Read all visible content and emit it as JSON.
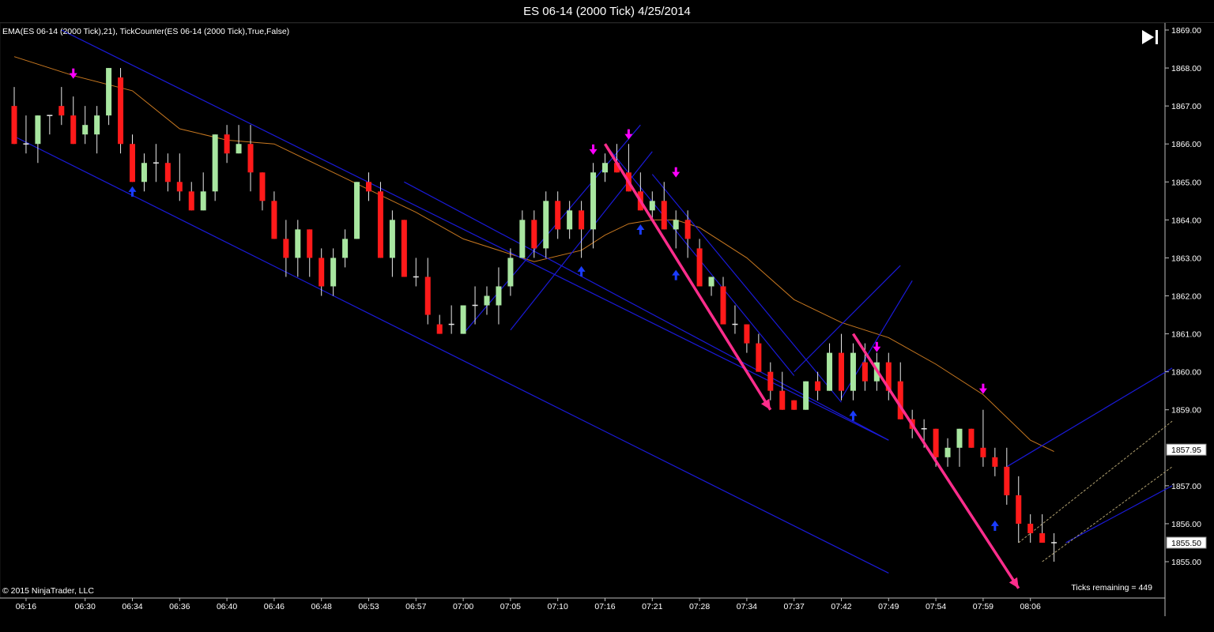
{
  "window": {
    "title": "ES 06-14 (2000 Tick)  4/25/2014"
  },
  "indicator_label": "EMA(ES 06-14 (2000 Tick),21), TickCounter(ES 06-14 (2000 Tick),True,False)",
  "copyright": "© 2015 NinjaTrader, LLC",
  "ticks_remaining": "Ticks remaining = 449",
  "icons": {
    "scroll_end": "skip-to-end-icon"
  },
  "colors": {
    "background": "#000000",
    "up_candle": "#a8e6a0",
    "down_candle": "#ff1a1a",
    "ema": "#c87820",
    "channel": "#1a1ad8",
    "trend_arrow": "#ff2d8c",
    "sell_arrow": "#ff00ff",
    "buy_arrow": "#1a3cff",
    "fib_line": "#b0a070"
  },
  "chart_data": {
    "type": "candlestick",
    "title": "ES 06-14 (2000 Tick)  4/25/2014",
    "ylim": [
      1854.3,
      1869.1
    ],
    "y_ticks": [
      "1869.00",
      "1868.00",
      "1867.00",
      "1866.00",
      "1865.00",
      "1864.00",
      "1863.00",
      "1862.00",
      "1861.00",
      "1860.00",
      "1859.00",
      "1857.00",
      "1856.00",
      "1855.00"
    ],
    "price_markers": [
      {
        "label": "1857.95",
        "value": 1857.95
      },
      {
        "label": "1855.50",
        "value": 1855.5
      }
    ],
    "x_tick_labels": [
      {
        "label": "06:16",
        "i": 1
      },
      {
        "label": "06:30",
        "i": 6
      },
      {
        "label": "06:34",
        "i": 10
      },
      {
        "label": "06:36",
        "i": 14
      },
      {
        "label": "06:40",
        "i": 18
      },
      {
        "label": "06:46",
        "i": 22
      },
      {
        "label": "06:48",
        "i": 26
      },
      {
        "label": "06:53",
        "i": 30
      },
      {
        "label": "06:57",
        "i": 34
      },
      {
        "label": "07:00",
        "i": 38
      },
      {
        "label": "07:05",
        "i": 42
      },
      {
        "label": "07:10",
        "i": 46
      },
      {
        "label": "07:16",
        "i": 50
      },
      {
        "label": "07:21",
        "i": 54
      },
      {
        "label": "07:28",
        "i": 58
      },
      {
        "label": "07:34",
        "i": 62
      },
      {
        "label": "07:37",
        "i": 66
      },
      {
        "label": "07:42",
        "i": 70
      },
      {
        "label": "07:49",
        "i": 74
      },
      {
        "label": "07:54",
        "i": 78
      },
      {
        "label": "07:59",
        "i": 82
      },
      {
        "label": "08:06",
        "i": 86
      }
    ],
    "candles": [
      {
        "o": 1867.0,
        "h": 1867.5,
        "l": 1866.0,
        "c": 1866.0
      },
      {
        "o": 1866.0,
        "h": 1866.75,
        "l": 1865.75,
        "c": 1866.0
      },
      {
        "o": 1866.0,
        "h": 1866.75,
        "l": 1865.5,
        "c": 1866.75
      },
      {
        "o": 1866.75,
        "h": 1866.75,
        "l": 1866.25,
        "c": 1866.75
      },
      {
        "o": 1867.0,
        "h": 1867.5,
        "l": 1866.5,
        "c": 1866.75
      },
      {
        "o": 1866.75,
        "h": 1867.25,
        "l": 1866.0,
        "c": 1866.0
      },
      {
        "o": 1866.25,
        "h": 1867.0,
        "l": 1866.0,
        "c": 1866.5
      },
      {
        "o": 1866.25,
        "h": 1867.0,
        "l": 1865.75,
        "c": 1866.75
      },
      {
        "o": 1866.75,
        "h": 1868.0,
        "l": 1866.5,
        "c": 1868.0
      },
      {
        "o": 1867.75,
        "h": 1868.0,
        "l": 1865.75,
        "c": 1866.0
      },
      {
        "o": 1866.0,
        "h": 1866.25,
        "l": 1865.0,
        "c": 1865.0
      },
      {
        "o": 1865.0,
        "h": 1865.75,
        "l": 1864.75,
        "c": 1865.5
      },
      {
        "o": 1865.5,
        "h": 1866.0,
        "l": 1865.0,
        "c": 1865.5
      },
      {
        "o": 1865.5,
        "h": 1865.75,
        "l": 1864.75,
        "c": 1865.0
      },
      {
        "o": 1865.0,
        "h": 1865.75,
        "l": 1864.5,
        "c": 1864.75
      },
      {
        "o": 1864.75,
        "h": 1865.0,
        "l": 1864.25,
        "c": 1864.25
      },
      {
        "o": 1864.25,
        "h": 1865.25,
        "l": 1864.25,
        "c": 1864.75
      },
      {
        "o": 1864.75,
        "h": 1866.25,
        "l": 1864.5,
        "c": 1866.25
      },
      {
        "o": 1866.25,
        "h": 1866.5,
        "l": 1865.5,
        "c": 1865.75
      },
      {
        "o": 1865.75,
        "h": 1866.5,
        "l": 1865.75,
        "c": 1866.0
      },
      {
        "o": 1866.0,
        "h": 1866.5,
        "l": 1864.75,
        "c": 1865.25
      },
      {
        "o": 1865.25,
        "h": 1865.25,
        "l": 1864.25,
        "c": 1864.5
      },
      {
        "o": 1864.5,
        "h": 1864.75,
        "l": 1863.5,
        "c": 1863.5
      },
      {
        "o": 1863.5,
        "h": 1864.0,
        "l": 1862.5,
        "c": 1863.0
      },
      {
        "o": 1863.0,
        "h": 1864.0,
        "l": 1862.5,
        "c": 1863.75
      },
      {
        "o": 1863.75,
        "h": 1863.75,
        "l": 1862.5,
        "c": 1863.0
      },
      {
        "o": 1863.0,
        "h": 1863.25,
        "l": 1862.0,
        "c": 1862.25
      },
      {
        "o": 1862.25,
        "h": 1863.25,
        "l": 1862.0,
        "c": 1863.0
      },
      {
        "o": 1863.0,
        "h": 1863.75,
        "l": 1862.75,
        "c": 1863.5
      },
      {
        "o": 1863.5,
        "h": 1865.0,
        "l": 1863.5,
        "c": 1865.0
      },
      {
        "o": 1865.0,
        "h": 1865.25,
        "l": 1864.5,
        "c": 1864.75
      },
      {
        "o": 1864.75,
        "h": 1865.0,
        "l": 1863.0,
        "c": 1863.0
      },
      {
        "o": 1863.0,
        "h": 1864.25,
        "l": 1862.5,
        "c": 1864.0
      },
      {
        "o": 1864.0,
        "h": 1864.0,
        "l": 1862.5,
        "c": 1862.5
      },
      {
        "o": 1862.5,
        "h": 1863.0,
        "l": 1862.25,
        "c": 1862.5
      },
      {
        "o": 1862.5,
        "h": 1863.0,
        "l": 1861.25,
        "c": 1861.5
      },
      {
        "o": 1861.25,
        "h": 1861.5,
        "l": 1861.0,
        "c": 1861.0
      },
      {
        "o": 1861.25,
        "h": 1861.75,
        "l": 1861.0,
        "c": 1861.25
      },
      {
        "o": 1861.0,
        "h": 1861.75,
        "l": 1861.0,
        "c": 1861.75
      },
      {
        "o": 1861.75,
        "h": 1862.25,
        "l": 1861.25,
        "c": 1861.75
      },
      {
        "o": 1861.75,
        "h": 1862.25,
        "l": 1861.5,
        "c": 1862.0
      },
      {
        "o": 1861.75,
        "h": 1862.75,
        "l": 1861.25,
        "c": 1862.25
      },
      {
        "o": 1862.25,
        "h": 1863.25,
        "l": 1862.0,
        "c": 1863.0
      },
      {
        "o": 1863.0,
        "h": 1864.25,
        "l": 1863.0,
        "c": 1864.0
      },
      {
        "o": 1864.0,
        "h": 1864.25,
        "l": 1863.0,
        "c": 1863.25
      },
      {
        "o": 1863.25,
        "h": 1864.75,
        "l": 1863.0,
        "c": 1864.5
      },
      {
        "o": 1864.5,
        "h": 1864.75,
        "l": 1863.5,
        "c": 1863.75
      },
      {
        "o": 1863.75,
        "h": 1864.5,
        "l": 1863.5,
        "c": 1864.25
      },
      {
        "o": 1864.25,
        "h": 1864.5,
        "l": 1863.0,
        "c": 1863.75
      },
      {
        "o": 1863.75,
        "h": 1865.5,
        "l": 1863.25,
        "c": 1865.25
      },
      {
        "o": 1865.25,
        "h": 1865.75,
        "l": 1865.0,
        "c": 1865.5
      },
      {
        "o": 1865.5,
        "h": 1866.0,
        "l": 1865.25,
        "c": 1865.25
      },
      {
        "o": 1865.25,
        "h": 1866.0,
        "l": 1864.75,
        "c": 1864.75
      },
      {
        "o": 1864.75,
        "h": 1865.25,
        "l": 1864.25,
        "c": 1864.25
      },
      {
        "o": 1864.25,
        "h": 1864.75,
        "l": 1864.0,
        "c": 1864.5
      },
      {
        "o": 1864.5,
        "h": 1865.0,
        "l": 1863.75,
        "c": 1863.75
      },
      {
        "o": 1863.75,
        "h": 1864.25,
        "l": 1863.25,
        "c": 1864.0
      },
      {
        "o": 1864.0,
        "h": 1864.25,
        "l": 1863.0,
        "c": 1863.5
      },
      {
        "o": 1863.25,
        "h": 1863.5,
        "l": 1862.25,
        "c": 1862.25
      },
      {
        "o": 1862.25,
        "h": 1862.5,
        "l": 1862.0,
        "c": 1862.5
      },
      {
        "o": 1862.25,
        "h": 1862.5,
        "l": 1861.25,
        "c": 1861.25
      },
      {
        "o": 1861.25,
        "h": 1861.75,
        "l": 1861.0,
        "c": 1861.25
      },
      {
        "o": 1861.25,
        "h": 1861.25,
        "l": 1860.5,
        "c": 1860.75
      },
      {
        "o": 1860.75,
        "h": 1861.0,
        "l": 1860.0,
        "c": 1860.0
      },
      {
        "o": 1860.0,
        "h": 1860.25,
        "l": 1859.25,
        "c": 1859.5
      },
      {
        "o": 1859.5,
        "h": 1860.0,
        "l": 1859.0,
        "c": 1859.0
      },
      {
        "o": 1859.25,
        "h": 1859.25,
        "l": 1859.0,
        "c": 1859.0
      },
      {
        "o": 1859.0,
        "h": 1859.75,
        "l": 1859.0,
        "c": 1859.75
      },
      {
        "o": 1859.75,
        "h": 1860.0,
        "l": 1859.25,
        "c": 1859.5
      },
      {
        "o": 1859.5,
        "h": 1860.75,
        "l": 1859.5,
        "c": 1860.5
      },
      {
        "o": 1860.5,
        "h": 1861.0,
        "l": 1859.25,
        "c": 1859.5
      },
      {
        "o": 1859.5,
        "h": 1860.75,
        "l": 1859.25,
        "c": 1860.5
      },
      {
        "o": 1860.25,
        "h": 1860.75,
        "l": 1859.5,
        "c": 1859.75
      },
      {
        "o": 1859.75,
        "h": 1860.5,
        "l": 1859.5,
        "c": 1860.25
      },
      {
        "o": 1860.25,
        "h": 1860.5,
        "l": 1859.25,
        "c": 1859.5
      },
      {
        "o": 1859.75,
        "h": 1860.25,
        "l": 1858.75,
        "c": 1858.75
      },
      {
        "o": 1858.75,
        "h": 1859.0,
        "l": 1858.25,
        "c": 1858.5
      },
      {
        "o": 1858.5,
        "h": 1858.75,
        "l": 1858.0,
        "c": 1858.5
      },
      {
        "o": 1858.5,
        "h": 1858.5,
        "l": 1857.5,
        "c": 1857.75
      },
      {
        "o": 1857.75,
        "h": 1858.25,
        "l": 1857.5,
        "c": 1858.0
      },
      {
        "o": 1858.0,
        "h": 1858.5,
        "l": 1857.5,
        "c": 1858.5
      },
      {
        "o": 1858.5,
        "h": 1858.5,
        "l": 1858.0,
        "c": 1858.0
      },
      {
        "o": 1858.0,
        "h": 1859.0,
        "l": 1857.5,
        "c": 1857.75
      },
      {
        "o": 1857.75,
        "h": 1858.0,
        "l": 1857.25,
        "c": 1857.5
      },
      {
        "o": 1857.5,
        "h": 1858.0,
        "l": 1856.5,
        "c": 1856.75
      },
      {
        "o": 1856.75,
        "h": 1857.25,
        "l": 1855.5,
        "c": 1856.0
      },
      {
        "o": 1856.0,
        "h": 1856.25,
        "l": 1855.5,
        "c": 1855.75
      },
      {
        "o": 1855.75,
        "h": 1856.25,
        "l": 1855.5,
        "c": 1855.5
      },
      {
        "o": 1855.5,
        "h": 1855.75,
        "l": 1855.0,
        "c": 1855.5
      }
    ],
    "ema": [
      [
        0,
        1868.3
      ],
      [
        5,
        1867.8
      ],
      [
        10,
        1867.4
      ],
      [
        14,
        1866.4
      ],
      [
        18,
        1866.1
      ],
      [
        22,
        1866.0
      ],
      [
        26,
        1865.4
      ],
      [
        30,
        1864.8
      ],
      [
        34,
        1864.2
      ],
      [
        38,
        1863.5
      ],
      [
        42,
        1863.1
      ],
      [
        44,
        1862.9
      ],
      [
        48,
        1863.2
      ],
      [
        50,
        1863.6
      ],
      [
        52,
        1863.9
      ],
      [
        54,
        1864.0
      ],
      [
        56,
        1864.0
      ],
      [
        58,
        1863.8
      ],
      [
        62,
        1863.0
      ],
      [
        66,
        1861.9
      ],
      [
        70,
        1861.3
      ],
      [
        74,
        1860.9
      ],
      [
        78,
        1860.2
      ],
      [
        82,
        1859.4
      ],
      [
        86,
        1858.2
      ],
      [
        88,
        1857.9
      ]
    ],
    "channels": [
      [
        [
          4,
          1869.0
        ],
        [
          74,
          1858.2
        ]
      ],
      [
        [
          0,
          1866.2
        ],
        [
          74,
          1854.7
        ]
      ],
      [
        [
          33,
          1865.0
        ],
        [
          74,
          1858.2
        ]
      ],
      [
        [
          38,
          1861.0
        ],
        [
          53,
          1866.5
        ]
      ],
      [
        [
          42,
          1861.1
        ],
        [
          54,
          1865.8
        ]
      ],
      [
        [
          50,
          1866.0
        ],
        [
          66,
          1859.9
        ]
      ],
      [
        [
          54,
          1865.2
        ],
        [
          70,
          1859.2
        ]
      ],
      [
        [
          66,
          1860.0
        ],
        [
          75,
          1862.8
        ]
      ],
      [
        [
          70,
          1859.3
        ],
        [
          76,
          1862.4
        ]
      ],
      [
        [
          84,
          1857.5
        ],
        [
          98,
          1860.1
        ]
      ],
      [
        [
          89,
          1855.5
        ],
        [
          98,
          1857.0
        ]
      ]
    ],
    "trend_arrows": [
      [
        [
          50,
          1866.0
        ],
        [
          64,
          1859.0
        ]
      ],
      [
        [
          71,
          1861.0
        ],
        [
          85,
          1854.3
        ]
      ]
    ],
    "fib_lines": [
      [
        [
          85,
          1855.5
        ],
        [
          98,
          1858.7
        ]
      ],
      [
        [
          87,
          1855.0
        ],
        [
          98,
          1857.5
        ]
      ]
    ],
    "sell_signals": [
      {
        "i": 5,
        "value": 1867.8
      },
      {
        "i": 49,
        "value": 1865.8
      },
      {
        "i": 52,
        "value": 1866.2
      },
      {
        "i": 56,
        "value": 1865.2
      },
      {
        "i": 73,
        "value": 1860.6
      },
      {
        "i": 82,
        "value": 1859.5
      }
    ],
    "buy_signals": [
      {
        "i": 10,
        "value": 1864.8
      },
      {
        "i": 48,
        "value": 1862.7
      },
      {
        "i": 53,
        "value": 1863.8
      },
      {
        "i": 56,
        "value": 1862.6
      },
      {
        "i": 71,
        "value": 1858.9
      },
      {
        "i": 83,
        "value": 1856.0
      }
    ]
  }
}
